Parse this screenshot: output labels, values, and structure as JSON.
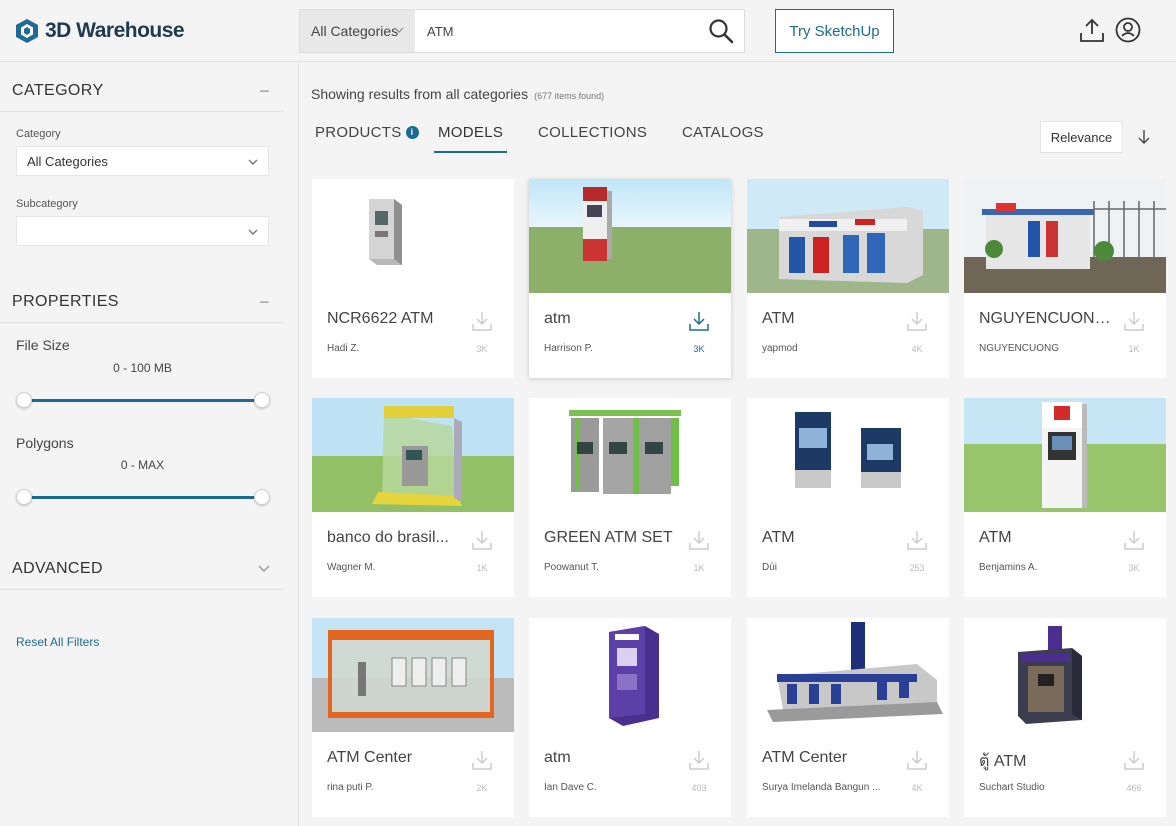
{
  "header": {
    "logo_text": "3D Warehouse",
    "search_category": "All Categories",
    "search_value": "ATM",
    "try_button": "Try SketchUp",
    "icons": [
      "upload-icon",
      "user-icon",
      "search-icon"
    ]
  },
  "sidebar": {
    "category": {
      "title": "CATEGORY",
      "toggle": "−",
      "category_label": "Category",
      "category_value": "All Categories",
      "subcategory_label": "Subcategory",
      "subcategory_value": ""
    },
    "properties": {
      "title": "PROPERTIES",
      "toggle": "−",
      "file_size_label": "File Size",
      "file_size_value": "0 - 100 MB",
      "polygons_label": "Polygons",
      "polygons_value": "0 - MAX"
    },
    "advanced": {
      "title": "ADVANCED",
      "toggle": "⌄"
    },
    "reset_link": "Reset All Filters"
  },
  "main": {
    "results_text": "Showing results from all categories",
    "results_count": "(677 items found)",
    "tabs": [
      {
        "label": "PRODUCTS",
        "active": false
      },
      {
        "label": "MODELS",
        "active": true
      },
      {
        "label": "COLLECTIONS",
        "active": false
      },
      {
        "label": "CATALOGS",
        "active": false
      }
    ],
    "info_glyph": "i",
    "sort_label": "Relevance",
    "accent_color": "#1a6a94"
  },
  "cards": [
    {
      "title": "NCR6622 ATM",
      "author": "Hadi Z.",
      "downloads": "3K"
    },
    {
      "title": "atm",
      "author": "Harrison P.",
      "downloads": "3K"
    },
    {
      "title": "ATM",
      "author": "yapmod",
      "downloads": "4K"
    },
    {
      "title": "NGUYENCUONG...",
      "author": "NGUYENCUONG",
      "downloads": "1K"
    },
    {
      "title": "banco do brasil...",
      "author": "Wagner M.",
      "downloads": "1K"
    },
    {
      "title": "GREEN ATM SET",
      "author": "Poowanut T.",
      "downloads": "1K"
    },
    {
      "title": "ATM",
      "author": "Dúi",
      "downloads": "253"
    },
    {
      "title": "ATM",
      "author": "Benjamins A.",
      "downloads": "3K"
    },
    {
      "title": "ATM Center",
      "author": "rina puti P.",
      "downloads": "2K"
    },
    {
      "title": "atm",
      "author": "Ian Dave C.",
      "downloads": "403"
    },
    {
      "title": "ATM Center",
      "author": "Surya Imelanda Bangun ...",
      "downloads": "4K"
    },
    {
      "title": "ตู้ ATM",
      "author": "Suchart Studio",
      "downloads": "466"
    }
  ]
}
